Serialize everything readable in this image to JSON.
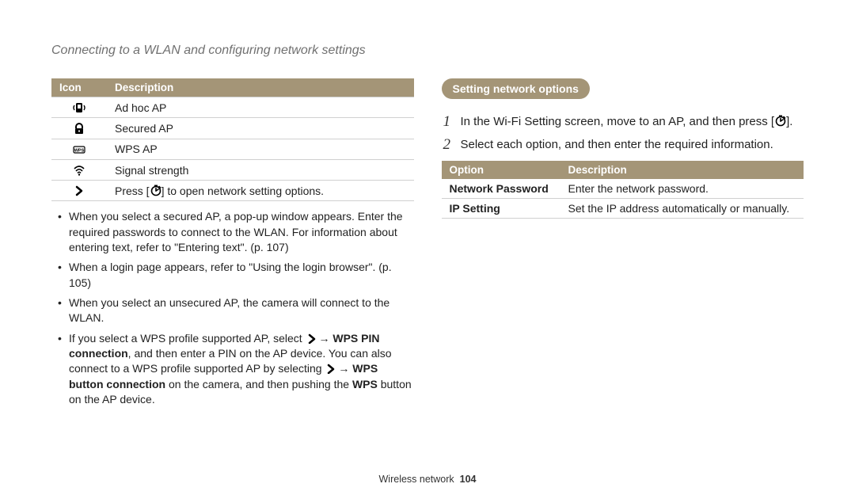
{
  "header": {
    "title": "Connecting to a WLAN and configuring network settings"
  },
  "left": {
    "table_headers": {
      "icon": "Icon",
      "desc": "Description"
    },
    "rows": [
      {
        "icon": "adhoc",
        "desc": "Ad hoc AP"
      },
      {
        "icon": "lock",
        "desc": "Secured AP"
      },
      {
        "icon": "wps",
        "desc": "WPS AP"
      },
      {
        "icon": "wifi",
        "desc": "Signal strength"
      },
      {
        "icon": "chevron",
        "desc_pre": "Press [",
        "desc_mid": "timer",
        "desc_post": "] to open network setting options."
      }
    ],
    "notes": [
      {
        "text": "When you select a secured AP, a pop-up window appears. Enter the required passwords to connect to the WLAN. For information about entering text, refer to \"Entering text\". (p. 107)"
      },
      {
        "text": "When a login page appears, refer to \"Using the login browser\". (p. 105)"
      },
      {
        "text": "When you select an unsecured AP, the camera will connect to the WLAN."
      },
      {
        "rich": true,
        "seg1": "If you select a WPS profile supported AP, select ",
        "seg2": " → ",
        "bold1": "WPS PIN connection",
        "seg3": ", and then enter a PIN on the AP device. You can also connect to a WPS profile supported AP by selecting ",
        "seg4": " → ",
        "bold2": "WPS button connection",
        "seg5": " on the camera, and then pushing the ",
        "bold3": "WPS",
        "seg6": " button on the AP device."
      }
    ]
  },
  "right": {
    "pill": "Setting network options",
    "steps": [
      {
        "pre": "In the Wi-Fi Setting screen, move to an AP, and then press [",
        "icon": "timer",
        "post": "]."
      },
      {
        "pre": "Select each option, and then enter the required information."
      }
    ],
    "opt_headers": {
      "opt": "Option",
      "desc": "Description"
    },
    "opt_rows": [
      {
        "name": "Network Password",
        "desc": "Enter the network password."
      },
      {
        "name": "IP Setting",
        "desc": "Set the IP address automatically or manually."
      }
    ]
  },
  "footer": {
    "label": "Wireless network",
    "page": "104"
  }
}
